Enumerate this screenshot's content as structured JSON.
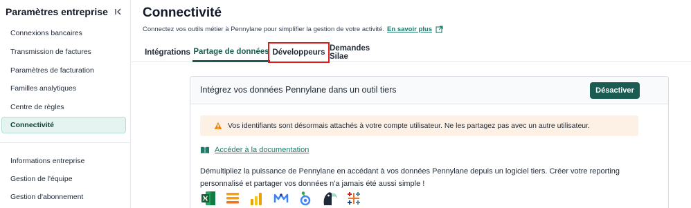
{
  "sidebar": {
    "title": "Paramètres entreprise",
    "items": [
      {
        "label": "Connexions bancaires"
      },
      {
        "label": "Transmission de factures"
      },
      {
        "label": "Paramètres de facturation"
      },
      {
        "label": "Familles analytiques"
      },
      {
        "label": "Centre de règles"
      },
      {
        "label": "Connectivité",
        "active": true
      },
      {
        "label": "Informations entreprise"
      },
      {
        "label": "Gestion de l'équipe"
      },
      {
        "label": "Gestion d'abonnement"
      }
    ]
  },
  "page": {
    "title": "Connectivité",
    "subtitle": "Connectez vos outils métier à Pennylane pour simplifier la gestion de votre activité.",
    "learn_more": "En savoir plus"
  },
  "tabs": [
    {
      "label": "Intégrations"
    },
    {
      "label": "Partage de données",
      "active": true
    },
    {
      "label": "Développeurs",
      "highlighted": true
    },
    {
      "label": "Demandes Silae"
    }
  ],
  "card": {
    "title": "Intégrez vos données Pennylane dans un outil tiers",
    "action": "Désactiver",
    "alert": "Vos identifiants sont désormais attachés à votre compte utilisateur. Ne les partagez pas avec un autre utilisateur.",
    "doc_link": "Accéder à la documentation",
    "description": "Démultipliez la puissance de Pennylane en accédant à vos données Pennylane depuis un logiciel tiers. Créer votre reporting personnalisé et partager vos données n'a jamais été aussi simple !"
  },
  "integration_logos": [
    "excel-icon",
    "sheets-stack-icon",
    "power-bi-icon",
    "mosaic-icon",
    "looker-icon",
    "toucan-icon",
    "tableau-icon"
  ],
  "colors": {
    "primary": "#1a5c52",
    "link": "#1f7a67",
    "alert_bg": "#fdf0e4",
    "highlight": "#d71f1f"
  }
}
